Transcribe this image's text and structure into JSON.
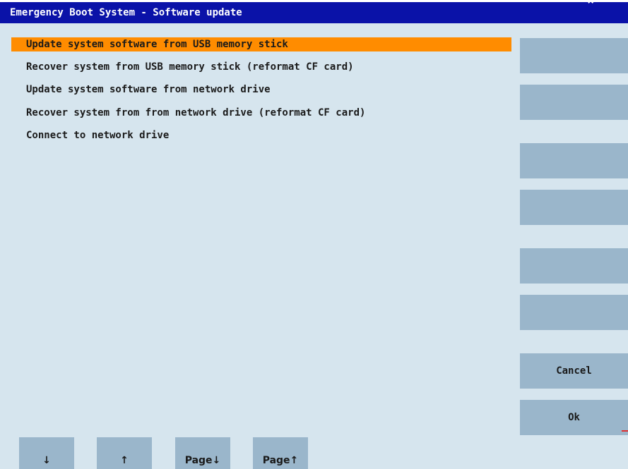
{
  "window": {
    "title": "Emergency Boot System - Software update",
    "corner_glyph": "×"
  },
  "menu": {
    "items": [
      {
        "label": "Update system software from USB memory stick",
        "selected": true
      },
      {
        "label": "Recover system from USB memory stick (reformat CF card)",
        "selected": false
      },
      {
        "label": "Update system software from network drive",
        "selected": false
      },
      {
        "label": "Recover system from from network drive (reformat CF card)",
        "selected": false
      },
      {
        "label": "Connect to network drive",
        "selected": false
      }
    ]
  },
  "softkeys": {
    "vertical": [
      {
        "label": ""
      },
      {
        "label": ""
      },
      {
        "label": ""
      },
      {
        "label": ""
      },
      {
        "label": ""
      },
      {
        "label": ""
      },
      {
        "label": "Cancel"
      },
      {
        "label": "Ok"
      }
    ],
    "horizontal": [
      {
        "label": "↓"
      },
      {
        "label": "↑"
      },
      {
        "label": "Page↓"
      },
      {
        "label": "Page↑"
      }
    ]
  },
  "colors": {
    "title_bar": "#0a12a8",
    "background": "#d6e5ee",
    "selection": "#ff8c00",
    "softkey": "#9ab6cb"
  }
}
